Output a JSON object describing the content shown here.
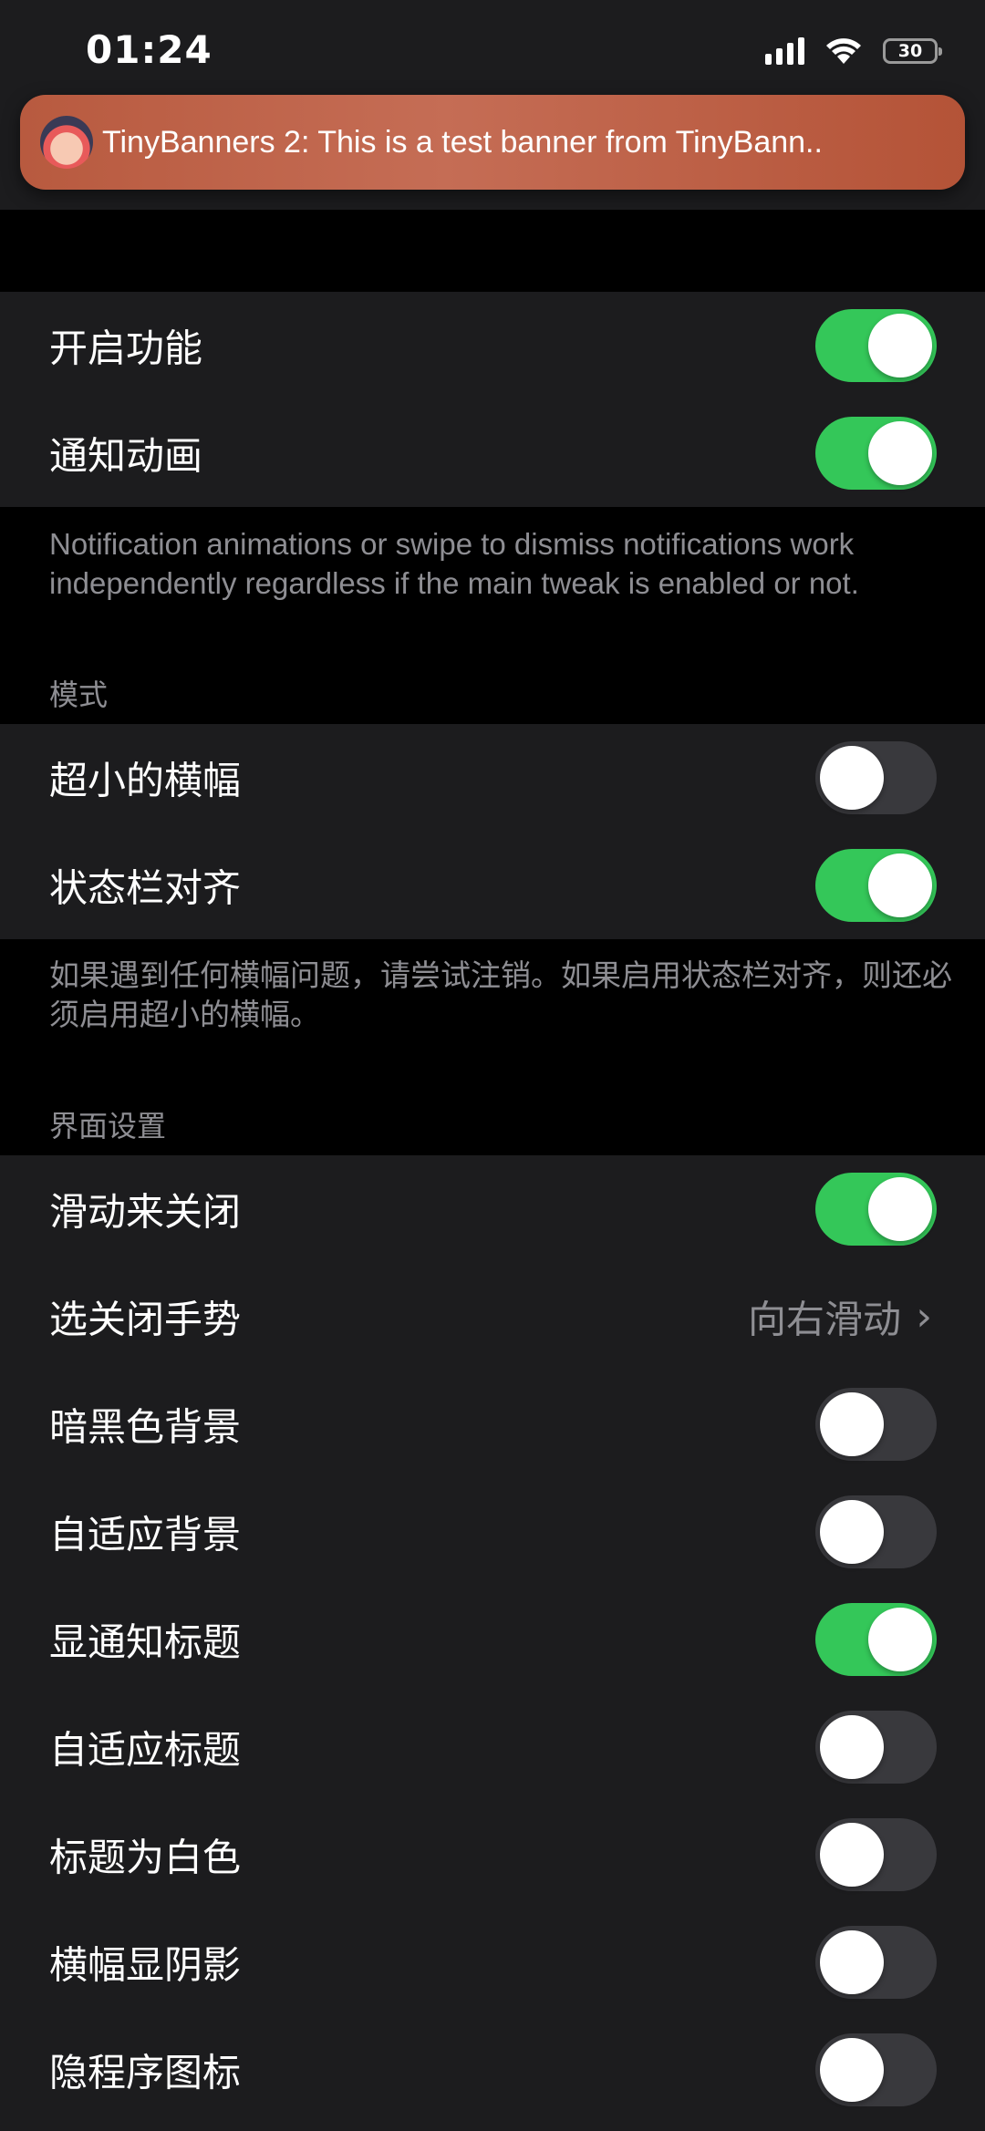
{
  "status_bar": {
    "time": "01:24",
    "battery": "30",
    "icons": [
      "signal-icon",
      "wifi-icon",
      "battery-icon"
    ]
  },
  "banner": {
    "text": "TinyBanners 2: This is a test banner from TinyBann..",
    "icon": "app-avatar-icon"
  },
  "section_main": {
    "rows": [
      {
        "label": "开启功能",
        "on": true
      },
      {
        "label": "通知动画",
        "on": true
      }
    ],
    "footer": "Notification animations or swipe to dismiss notifications work independently regardless if the main tweak is enabled or not."
  },
  "section_mode": {
    "header": "模式",
    "rows": [
      {
        "label": "超小的横幅",
        "on": false
      },
      {
        "label": "状态栏对齐",
        "on": true
      }
    ],
    "footer": "如果遇到任何横幅问题，请尝试注销。如果启用状态栏对齐，则还必须启用超小的横幅。"
  },
  "section_ui": {
    "header": "界面设置",
    "rows": [
      {
        "label": "滑动来关闭",
        "on": true
      },
      {
        "label": "选关闭手势",
        "value": "向右滑动"
      },
      {
        "label": "暗黑色背景",
        "on": false
      },
      {
        "label": "自适应背景",
        "on": false
      },
      {
        "label": "显通知标题",
        "on": true
      },
      {
        "label": "自适应标题",
        "on": false
      },
      {
        "label": "标题为白色",
        "on": false
      },
      {
        "label": "横幅显阴影",
        "on": false
      },
      {
        "label": "隐程序图标",
        "on": false
      }
    ]
  },
  "colors": {
    "toggle_on": "#34c759",
    "toggle_off": "#39393d",
    "cell_bg": "#1c1c1e",
    "secondary_text": "#8e8e93"
  }
}
